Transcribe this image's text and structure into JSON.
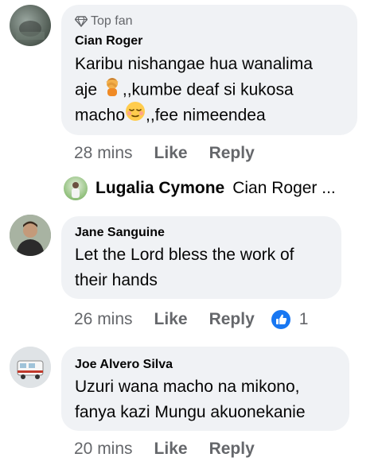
{
  "comments": [
    {
      "badge": "Top fan",
      "author": "Cian Roger",
      "line1": "Karibu nishangae hua wanalima",
      "line2a": "aje ",
      "line2b": ",,kumbe deaf si kukosa",
      "line3a": "macho",
      "line3b": ",,fee nimeendea",
      "time": "28 mins",
      "like": "Like",
      "reply": "Reply"
    },
    {
      "author": "Jane Sanguine",
      "line1": "Let the Lord bless the work of",
      "line2": "their hands",
      "time": "26 mins",
      "like": "Like",
      "reply": "Reply",
      "reaction_count": "1"
    },
    {
      "author": "Joe Alvero Silva",
      "line1": "Uzuri wana macho na mikono,",
      "line2": "fanya kazi Mungu akuonekanie",
      "time": "20 mins",
      "like": "Like",
      "reply": "Reply"
    }
  ],
  "reply_preview": {
    "name": "Lugalia Cymone",
    "snippet": "Cian Roger ..."
  },
  "colors": {
    "bubble": "#f0f2f5",
    "meta": "#65676b",
    "like_reaction": "#1877f2"
  },
  "icons": [
    "diamond-icon",
    "facepalm-emoji-icon",
    "relieved-face-emoji-icon",
    "thumbs-up-reaction-icon"
  ]
}
